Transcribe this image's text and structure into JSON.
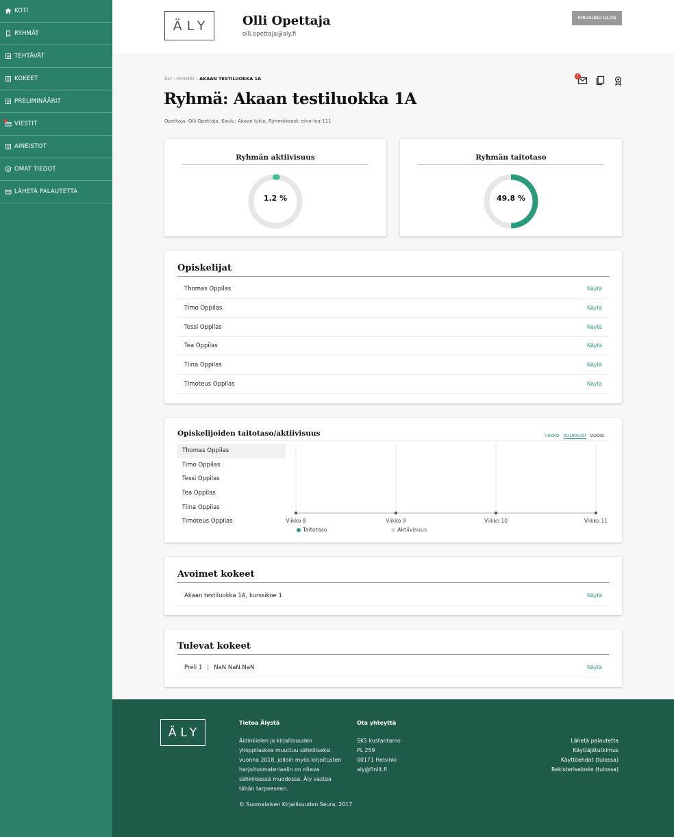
{
  "sidebar": {
    "items": [
      {
        "label": "Koti",
        "icon": "home-icon"
      },
      {
        "label": "Ryhmät",
        "icon": "bookmark-icon"
      },
      {
        "label": "Tehtävät",
        "icon": "document-icon"
      },
      {
        "label": "Kokeet",
        "icon": "document-icon"
      },
      {
        "label": "Preliminäärit",
        "icon": "document-icon"
      },
      {
        "label": "Viestit",
        "icon": "mail-icon"
      },
      {
        "label": "Aineistot",
        "icon": "document-icon"
      },
      {
        "label": "Omat tiedot",
        "icon": "shield-icon"
      },
      {
        "label": "Lähetä palautetta",
        "icon": "mail-icon"
      }
    ]
  },
  "header": {
    "logo": "ÄLY",
    "user_name": "Olli Opettaja",
    "user_email": "olli.opettaja@aly.fi",
    "logout_label": "KIRJAUDU ULOS"
  },
  "breadcrumb": {
    "root": "ÄLY",
    "mid": "RYHMÄT",
    "current": "AKAAN TESTILUOKKA 1A"
  },
  "page": {
    "title": "Ryhmä: Akaan testiluokka 1A",
    "meta": "Opettaja: Olli Opettaja, Koulu: Akaan lukio, Ryhmäkoodi: eino-lea-111",
    "message_badge": "1"
  },
  "stats": {
    "activity": {
      "title": "Ryhmän aktiivisuus",
      "value_label": "1.2 %",
      "value": 1.2
    },
    "skill": {
      "title": "Ryhmän taitotaso",
      "value_label": "49.8 %",
      "value": 49.8
    }
  },
  "students": {
    "title": "Opiskelijat",
    "show_label": "Näytä",
    "rows": [
      "Thomas Oppilas",
      "Timo Oppilas",
      "Tessi Oppilas",
      "Tea Oppilas",
      "Tiina Oppilas",
      "Timoteus Oppilas"
    ]
  },
  "progress": {
    "title": "Opiskelijoiden taitotaso/aktiivisuus",
    "periods": [
      "VIIKKO",
      "KUUKAUSI",
      "VUOSI"
    ],
    "students": [
      "Thomas Oppilas",
      "Timo Oppilas",
      "Tessi Oppilas",
      "Tea Oppilas",
      "Tiina Oppilas",
      "Timoteus Oppilas"
    ],
    "legend_skill": "Taitotaso",
    "legend_activity": "Aktiivisuus"
  },
  "chart_data": {
    "type": "line",
    "categories": [
      "Viikko 8",
      "Viikko 9",
      "Viikko 10",
      "Viikko 11"
    ],
    "series": [
      {
        "name": "Taitotaso",
        "values": [
          0,
          0,
          0,
          0
        ]
      },
      {
        "name": "Aktiivisuus",
        "values": [
          0,
          0,
          0,
          0
        ]
      }
    ],
    "colors": {
      "skill": "#2a9a7d",
      "activity": "#d6d6d6"
    }
  },
  "open_exams": {
    "title": "Avoimet kokeet",
    "show_label": "Näytä",
    "rows": [
      "Akaan testiluokka 1A, kurssikoe 1"
    ]
  },
  "upcoming_exams": {
    "title": "Tulevat kokeet",
    "show_label": "Näytä",
    "rows": [
      {
        "name": "Preli 1",
        "date": "NaN.NaN.NaN"
      }
    ]
  },
  "footer": {
    "logo": "ÄLY",
    "about_title": "Tietoa Älystä",
    "about_text": "Äidinkielen ja kirjallisuuden ylioppilaskoe muuttuu sähköiseksi vuonna 2018, jolloin myös kirjoitusten harjoitusmateriaalin on oltava sähköisessä muodossa. Äly vastaa tähän tarpeeseen.",
    "contact_title": "Ota yhteyttä",
    "contact_lines": [
      "SKS kustantamo",
      "PL 259",
      "00171 Helsinki",
      "aly@finlit.fi"
    ],
    "links": [
      "Lähetä palautetta",
      "Käyttäjätutkimus",
      "Käyttöehdot (tulossa)",
      "Rekisteriseloste (tulossa)"
    ],
    "copyright": "© Suomalaisen Kirjallisuuden Seura, 2017"
  },
  "colors": {
    "sidebar": "#2a8068",
    "accent": "#2a9a7d",
    "footer": "#1f5b49",
    "alert": "#e53935"
  }
}
